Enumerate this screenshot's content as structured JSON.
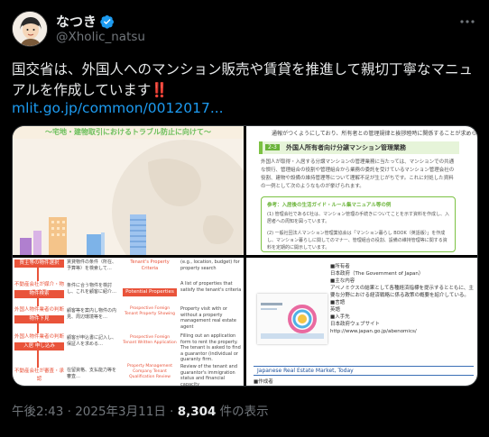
{
  "author": {
    "name": "なつき",
    "handle": "@Xholic_natsu",
    "verified_color": "#1d9bf0"
  },
  "post": {
    "text_line1": "国交省は、外国人へのマンション販売や賃貸を推進して親切丁寧なマニュ",
    "text_line2": "アルを作成しています",
    "emphasis": "‼️",
    "link": "mlit.go.jp/common/0012017..."
  },
  "media": {
    "tile1": {
      "banner": "～宅地・建物取引におけるトラブル防止に向けて～"
    },
    "tile2": {
      "top_note": "通報がつくようにしており、所有者との管理規律と挨拶睦時に関係することが求められます。",
      "section_num": "2-3",
      "section_title": "外国人所有者向け分譲マンション管理業務",
      "para": "外国人が取得・入居する分譲マンションの管理業務に当たっては、マンションでの共通な慣行、管理組合の役割や管理組合から業務の委託を受けているマンション管理会社の役割、建物や設備の維持管理等について理解不足が生じがちです。これに対処した資料の一例として次のようなものが挙げられます。",
      "box_head": "参考：入居後の生活ガイド・ルール集マニュアル等の例",
      "box_l1": "(1) 管理会社であるC社は、マンション管理の手続きについてことを示す資料を作成し、入居者への周知を図っています。",
      "box_l2": "(2) 一般社団法人マンション管理業協会は「マンション暮らし BOOK（英語版）」を作成し、マンション暮らしに関してのマナー、管理組合の役割、設備の維持管理等に関する資料を定期的に開示しています。"
    },
    "tile3": {
      "labels_left": [
        "買主等の物件選択",
        "不動産会社が媒介・物件検索",
        "外国人物件業者の判断",
        "物件下見",
        "外国人物件業者の判断",
        "入居 申し込み",
        "不動産会社が審査・承認"
      ],
      "labels_right": [
        "Tenant's Property Criteria",
        "Potential Properties",
        "Prospective Foreign Tenant Property Showing",
        "Prospective Foreign Tenant Written Application",
        "Property Management Company Tenant Qualification Review"
      ],
      "right_notes": [
        "(e.g., location, budget) for property search",
        "A list of properties that satisfy the tenant's criteria",
        "Property visit with or without a property management real estate agent",
        "Filling out an application form to rent the property. The tenant is asked to find a guarantor (individual or guaranty firm.",
        "Review of the tenant and guarantor's immigration status and financial capacity"
      ]
    },
    "tile4": {
      "rows": [
        "■所有者",
        "日本政府（The Government of Japan）",
        "■主な内容",
        "アベノミクスの結果として各種経済指標を提示するとともに、主要な分野における経済戦略に係る政策の概要を紹介している。",
        "■言語",
        "英語",
        "■入手先",
        "日本政府ウェブサイト",
        "http://www.japan.go.jp/abenomics/"
      ],
      "section": "Japanese Real Estate Market, Today",
      "after": "■作成者"
    }
  },
  "footer": {
    "time": "午後2:43 · 2025年3月11日 · ",
    "views": "8,304",
    "views_suffix": " 件の表示"
  },
  "colors": {
    "link": "#1d9bf0",
    "muted": "#71767b",
    "text": "#e7e9ea",
    "green": "#6bb43a",
    "red": "#e9533a"
  }
}
